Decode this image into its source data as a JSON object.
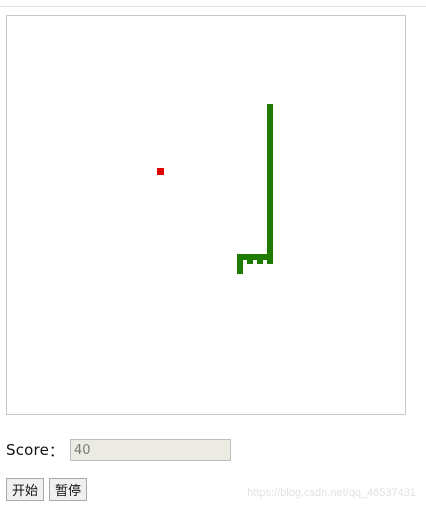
{
  "game": {
    "colors": {
      "snake": "#1f7a00",
      "food": "#e00000",
      "board_border": "#c8c8c8"
    },
    "snake_cells": [
      [
        26,
        9
      ],
      [
        26,
        10
      ],
      [
        26,
        11
      ],
      [
        26,
        12
      ],
      [
        26,
        13
      ],
      [
        26,
        14
      ],
      [
        26,
        15
      ],
      [
        26,
        16
      ],
      [
        26,
        17
      ],
      [
        26,
        18
      ],
      [
        26,
        19
      ],
      [
        26,
        20
      ],
      [
        26,
        21
      ],
      [
        26,
        22
      ],
      [
        26,
        23
      ],
      [
        26,
        24
      ],
      [
        25,
        24
      ],
      [
        24,
        24
      ],
      [
        23,
        24
      ],
      [
        23,
        25
      ]
    ],
    "food_cell": [
      15,
      15
    ]
  },
  "score": {
    "label": "Score",
    "colon": "：",
    "value": "40"
  },
  "controls": {
    "start_label": "开始",
    "pause_label": "暂停"
  },
  "watermark": {
    "text": "https://blog.csdn.net/qq_46537431"
  }
}
